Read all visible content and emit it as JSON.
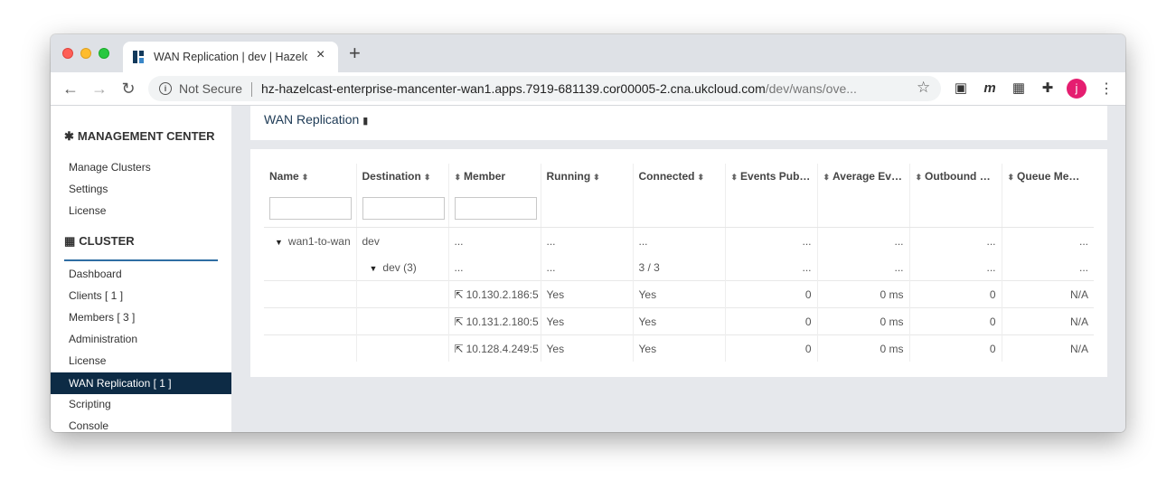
{
  "browser": {
    "tab_title": "WAN Replication | dev | Hazelcast",
    "new_tab": "+",
    "security_label": "Not Secure",
    "url_host": "hz-hazelcast-enterprise-mancenter-wan1.apps.7919-681139.cor00005-2.cna.ukcloud.com",
    "url_path": "/dev/wans/ove...",
    "profile_initial": "j",
    "extension_m": "m"
  },
  "sidebar": {
    "management_header": "MANAGEMENT CENTER",
    "management_links": [
      "Manage Clusters",
      "Settings",
      "License"
    ],
    "cluster_header": "CLUSTER",
    "cluster_links": [
      "Dashboard",
      "Clients [ 1 ]",
      "Members [ 3 ]",
      "Administration",
      "License",
      "WAN Replication [ 1 ]",
      "Scripting",
      "Console"
    ],
    "active_item": "WAN Replication [ 1 ]"
  },
  "page": {
    "title": "WAN Replication"
  },
  "table": {
    "columns": [
      "Name",
      "Destination",
      "Member",
      "Running",
      "Connected",
      "Events Pub…",
      "Average Ev…",
      "Outbound …",
      "Queue Me…"
    ],
    "rows": [
      {
        "name": "wan1-to-wan",
        "destination": "dev",
        "member": "...",
        "running": "...",
        "connected": "...",
        "events": "...",
        "average": "...",
        "outbound": "...",
        "queue": "..."
      },
      {
        "name": "",
        "destination": "dev (3)",
        "member": "...",
        "running": "...",
        "connected": "3 / 3",
        "events": "...",
        "average": "...",
        "outbound": "...",
        "queue": "..."
      },
      {
        "name": "",
        "destination": "",
        "member": "10.130.2.186:5",
        "running": "Yes",
        "connected": "Yes",
        "events": "0",
        "average": "0 ms",
        "outbound": "0",
        "queue": "N/A"
      },
      {
        "name": "",
        "destination": "",
        "member": "10.131.2.180:5",
        "running": "Yes",
        "connected": "Yes",
        "events": "0",
        "average": "0 ms",
        "outbound": "0",
        "queue": "N/A"
      },
      {
        "name": "",
        "destination": "",
        "member": "10.128.4.249:5",
        "running": "Yes",
        "connected": "Yes",
        "events": "0",
        "average": "0 ms",
        "outbound": "0",
        "queue": "N/A"
      }
    ]
  },
  "colors": {
    "sidebar_active_bg": "#0d2b45",
    "cluster_underline": "#2f6ea3",
    "title_text": "#1d3a55"
  }
}
